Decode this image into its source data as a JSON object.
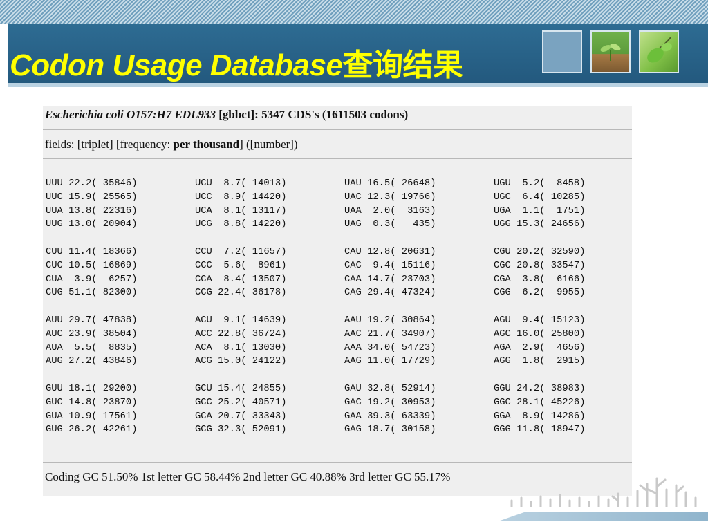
{
  "slide": {
    "title_en": "Codon Usage Database",
    "title_cn": "查询结果"
  },
  "result": {
    "organism": "Escherichia coli O157:H7 EDL933",
    "source": "[gbbct]:",
    "stats": "5347 CDS's (1611503 codons)",
    "fields_prefix": "fields: [triplet] [frequency: ",
    "fields_bold": "per thousand",
    "fields_suffix": "] ([number])",
    "footer": "Coding GC 51.50% 1st letter GC 58.44% 2nd letter GC 40.88% 3rd letter GC 55.17%"
  },
  "chart_data": {
    "type": "table",
    "columns": [
      "triplet",
      "frequency_per_thousand",
      "number"
    ],
    "groups": [
      [
        [
          [
            "UUU",
            22.2,
            35846
          ],
          [
            "UCU",
            8.7,
            14013
          ],
          [
            "UAU",
            16.5,
            26648
          ],
          [
            "UGU",
            5.2,
            8458
          ]
        ],
        [
          [
            "UUC",
            15.9,
            25565
          ],
          [
            "UCC",
            8.9,
            14420
          ],
          [
            "UAC",
            12.3,
            19766
          ],
          [
            "UGC",
            6.4,
            10285
          ]
        ],
        [
          [
            "UUA",
            13.8,
            22316
          ],
          [
            "UCA",
            8.1,
            13117
          ],
          [
            "UAA",
            2.0,
            3163
          ],
          [
            "UGA",
            1.1,
            1751
          ]
        ],
        [
          [
            "UUG",
            13.0,
            20904
          ],
          [
            "UCG",
            8.8,
            14220
          ],
          [
            "UAG",
            0.3,
            435
          ],
          [
            "UGG",
            15.3,
            24656
          ]
        ]
      ],
      [
        [
          [
            "CUU",
            11.4,
            18366
          ],
          [
            "CCU",
            7.2,
            11657
          ],
          [
            "CAU",
            12.8,
            20631
          ],
          [
            "CGU",
            20.2,
            32590
          ]
        ],
        [
          [
            "CUC",
            10.5,
            16869
          ],
          [
            "CCC",
            5.6,
            8961
          ],
          [
            "CAC",
            9.4,
            15116
          ],
          [
            "CGC",
            20.8,
            33547
          ]
        ],
        [
          [
            "CUA",
            3.9,
            6257
          ],
          [
            "CCA",
            8.4,
            13507
          ],
          [
            "CAA",
            14.7,
            23703
          ],
          [
            "CGA",
            3.8,
            6166
          ]
        ],
        [
          [
            "CUG",
            51.1,
            82300
          ],
          [
            "CCG",
            22.4,
            36178
          ],
          [
            "CAG",
            29.4,
            47324
          ],
          [
            "CGG",
            6.2,
            9955
          ]
        ]
      ],
      [
        [
          [
            "AUU",
            29.7,
            47838
          ],
          [
            "ACU",
            9.1,
            14639
          ],
          [
            "AAU",
            19.2,
            30864
          ],
          [
            "AGU",
            9.4,
            15123
          ]
        ],
        [
          [
            "AUC",
            23.9,
            38504
          ],
          [
            "ACC",
            22.8,
            36724
          ],
          [
            "AAC",
            21.7,
            34907
          ],
          [
            "AGC",
            16.0,
            25800
          ]
        ],
        [
          [
            "AUA",
            5.5,
            8835
          ],
          [
            "ACA",
            8.1,
            13030
          ],
          [
            "AAA",
            34.0,
            54723
          ],
          [
            "AGA",
            2.9,
            4656
          ]
        ],
        [
          [
            "AUG",
            27.2,
            43846
          ],
          [
            "ACG",
            15.0,
            24122
          ],
          [
            "AAG",
            11.0,
            17729
          ],
          [
            "AGG",
            1.8,
            2915
          ]
        ]
      ],
      [
        [
          [
            "GUU",
            18.1,
            29200
          ],
          [
            "GCU",
            15.4,
            24855
          ],
          [
            "GAU",
            32.8,
            52914
          ],
          [
            "GGU",
            24.2,
            38983
          ]
        ],
        [
          [
            "GUC",
            14.8,
            23870
          ],
          [
            "GCC",
            25.2,
            40571
          ],
          [
            "GAC",
            19.2,
            30953
          ],
          [
            "GGC",
            28.1,
            45226
          ]
        ],
        [
          [
            "GUA",
            10.9,
            17561
          ],
          [
            "GCA",
            20.7,
            33343
          ],
          [
            "GAA",
            39.3,
            63339
          ],
          [
            "GGA",
            8.9,
            14286
          ]
        ],
        [
          [
            "GUG",
            26.2,
            42261
          ],
          [
            "GCG",
            32.3,
            52091
          ],
          [
            "GAG",
            18.7,
            30158
          ],
          [
            "GGG",
            11.8,
            18947
          ]
        ]
      ]
    ]
  }
}
